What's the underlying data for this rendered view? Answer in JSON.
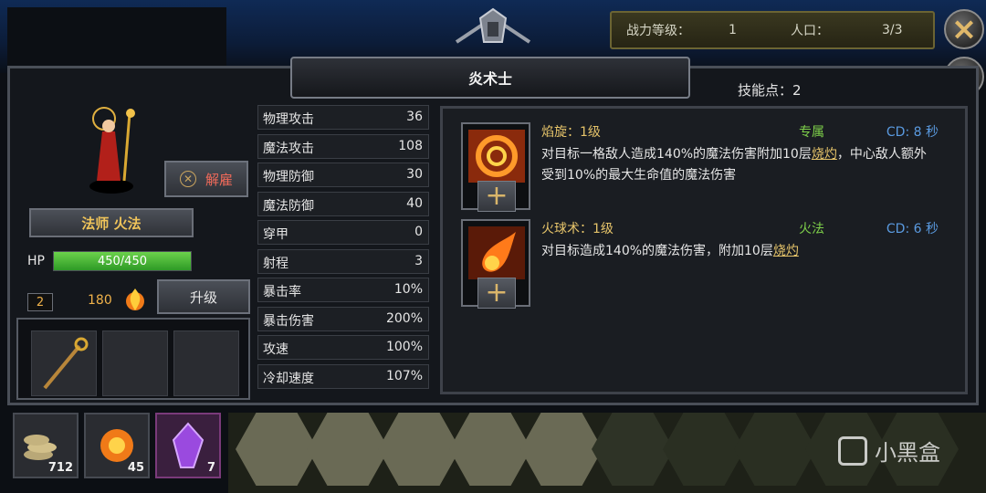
{
  "top_bar": {
    "power_label": "战力等级：",
    "power_value": "1",
    "population_label": "人口：",
    "population_value": "3/3"
  },
  "panel": {
    "title": "炎术士",
    "skill_points": "技能点：2"
  },
  "hero": {
    "dismiss_label": "解雇",
    "class_label": "法师 火法",
    "hp_label": "HP",
    "hp_text": "450/450",
    "hp_fraction": 1.0,
    "level": "2",
    "upgrade_cost": "180",
    "upgrade_label": "升级"
  },
  "stats": [
    {
      "label": "物理攻击",
      "value": "36"
    },
    {
      "label": "魔法攻击",
      "value": "108"
    },
    {
      "label": "物理防御",
      "value": "30"
    },
    {
      "label": "魔法防御",
      "value": "40"
    },
    {
      "label": "穿甲",
      "value": "0"
    },
    {
      "label": "射程",
      "value": "3"
    },
    {
      "label": "暴击率",
      "value": "10%"
    },
    {
      "label": "暴击伤害",
      "value": "200%"
    },
    {
      "label": "攻速",
      "value": "100%"
    },
    {
      "label": "冷却速度",
      "value": "107%"
    }
  ],
  "skills": [
    {
      "name": "焰旋：1级",
      "tag": "专属",
      "cd": "CD: 8 秒",
      "desc_pre": "对目标一格敌人造成140%的魔法伤害附加10层",
      "keyword": "烧灼",
      "desc_post": "，中心敌人额外受到10%的最大生命值的魔法伤害",
      "icon": "flame-swirl-icon"
    },
    {
      "name": "火球术：1级",
      "tag": "火法",
      "cd": "CD: 6 秒",
      "desc_pre": "对目标造成140%的魔法伤害，附加10层",
      "keyword": "烧灼",
      "desc_post": "",
      "icon": "fireball-icon"
    }
  ],
  "inventory": [
    {
      "icon": "coins-icon",
      "count": "712"
    },
    {
      "icon": "fire-essence-icon",
      "count": "45"
    },
    {
      "icon": "purple-crystal-icon",
      "count": "7"
    }
  ],
  "watermark": "小黑盒",
  "colors": {
    "gold": "#e6c46a",
    "green": "#7ed04a",
    "cd_blue": "#5a9ae0",
    "dismiss_red": "#f06a5a"
  }
}
